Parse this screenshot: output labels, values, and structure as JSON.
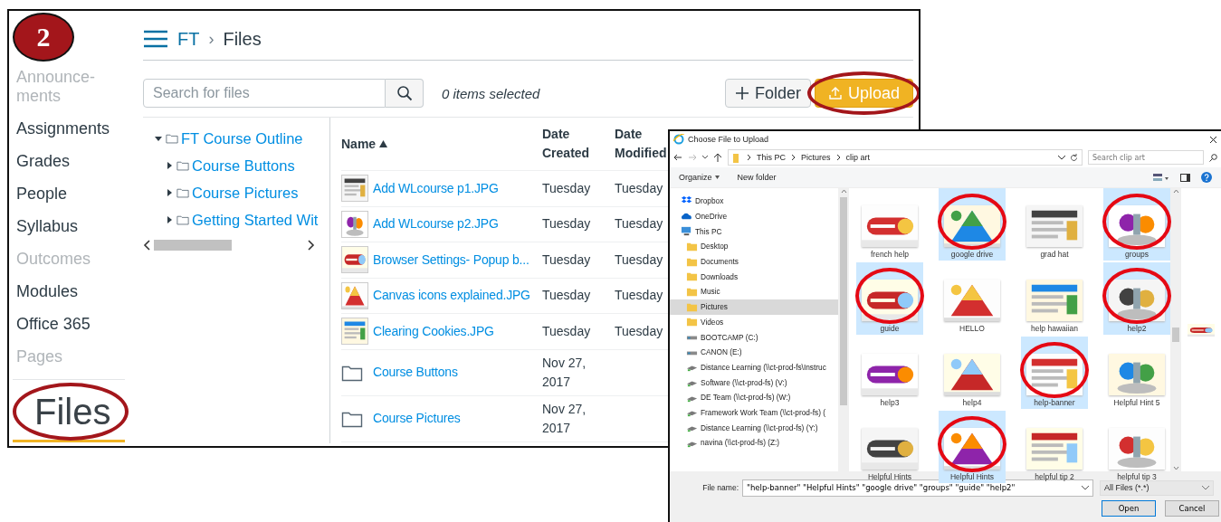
{
  "step_badge": {
    "label": "2"
  },
  "course_nav": {
    "items": [
      {
        "label": "Announce-ments",
        "muted": true,
        "selected": false,
        "circled": false
      },
      {
        "label": "Assignments",
        "muted": false,
        "selected": false,
        "circled": false
      },
      {
        "label": "Grades",
        "muted": false,
        "selected": false,
        "circled": false
      },
      {
        "label": "People",
        "muted": false,
        "selected": false,
        "circled": false
      },
      {
        "label": "Syllabus",
        "muted": false,
        "selected": false,
        "circled": false
      },
      {
        "label": "Outcomes",
        "muted": true,
        "selected": false,
        "circled": false
      },
      {
        "label": "Modules",
        "muted": false,
        "selected": false,
        "circled": false
      },
      {
        "label": "Office 365",
        "muted": false,
        "selected": false,
        "circled": false
      },
      {
        "label": "Pages",
        "muted": true,
        "selected": false,
        "circled": false
      },
      {
        "label": "Files",
        "muted": false,
        "selected": true,
        "circled": true
      }
    ]
  },
  "breadcrumbs": {
    "separator": "›",
    "items": [
      {
        "label": "FT",
        "kind": "link"
      },
      {
        "label": "Files",
        "kind": "current"
      }
    ]
  },
  "toolbar": {
    "search": {
      "placeholder": "Search for files"
    },
    "selection_count": "0 items selected",
    "buttons": [
      {
        "label": "Folder",
        "kind": "add",
        "circled": false
      },
      {
        "label": "Upload",
        "kind": "upload",
        "circled": true
      }
    ]
  },
  "folder_tree": [
    {
      "label": "FT Course Outline",
      "expanded": true,
      "children": [
        {
          "label": "Course Buttons",
          "expanded": false
        },
        {
          "label": "Course Pictures",
          "expanded": false
        },
        {
          "label": "Getting Started Wit",
          "expanded": false
        }
      ]
    }
  ],
  "file_table": {
    "columns": [
      {
        "label": "Name",
        "sorted": true
      },
      {
        "label": "Date Created",
        "sorted": false
      },
      {
        "label": "Date Modified",
        "sorted": false
      }
    ],
    "rows": [
      {
        "name": "Add WLcourse p1.JPG",
        "created": "Tuesday",
        "modified": "Tuesday"
      },
      {
        "name": "Add WLcourse p2.JPG",
        "created": "Tuesday",
        "modified": "Tuesday"
      },
      {
        "name": "Browser Settings- Popup b...",
        "created": "Tuesday",
        "modified": "Tuesday"
      },
      {
        "name": "Canvas icons explained.JPG",
        "created": "Tuesday",
        "modified": "Tuesday"
      },
      {
        "name": "Clearing Cookies.JPG",
        "created": "Tuesday",
        "modified": "Tuesday"
      },
      {
        "kind": "folder",
        "name": "Course Buttons",
        "created": "Nov 27, 2017"
      },
      {
        "kind": "folder",
        "name": "Course Pictures",
        "created": "Nov 27, 2017"
      }
    ]
  },
  "upload_dialog": {
    "title": "Choose File to Upload",
    "path": [
      "This PC",
      "Pictures",
      "clip art"
    ],
    "search": {
      "placeholder": "Search clip art"
    },
    "toolbar": [
      "Organize",
      "New folder"
    ],
    "nav": [
      {
        "label": "Dropbox",
        "kind": "dropbox",
        "selected": false
      },
      {
        "label": "OneDrive",
        "kind": "cloud",
        "selected": false
      },
      {
        "label": "This PC",
        "kind": "pc",
        "selected": false,
        "children": [
          {
            "label": "Desktop",
            "kind": "folder",
            "selected": false
          },
          {
            "label": "Documents",
            "kind": "folder",
            "selected": false
          },
          {
            "label": "Downloads",
            "kind": "folder",
            "selected": false
          },
          {
            "label": "Music",
            "kind": "folder",
            "selected": false
          },
          {
            "label": "Pictures",
            "kind": "folder",
            "selected": true
          },
          {
            "label": "Videos",
            "kind": "folder",
            "selected": false
          },
          {
            "label": "BOOTCAMP (C:)",
            "kind": "drive",
            "selected": false
          },
          {
            "label": "CANON (E:)",
            "kind": "drive",
            "selected": false
          },
          {
            "label": "Distance Learning (\\\\ct-prod-fs\\Instruc",
            "kind": "network",
            "selected": false
          },
          {
            "label": "Software (\\\\ct-prod-fs) (V:)",
            "kind": "network",
            "selected": false
          },
          {
            "label": "DE Team (\\\\ct-prod-fs) (W:)",
            "kind": "network",
            "selected": false
          },
          {
            "label": "Framework Work Team (\\\\ct-prod-fs) (",
            "kind": "network",
            "selected": false
          },
          {
            "label": "Distance Learning (\\\\ct-prod-fs) (Y:)",
            "kind": "network",
            "selected": false
          },
          {
            "label": "navina (\\\\ct-prod-fs) (Z:)",
            "kind": "network",
            "selected": false
          }
        ]
      }
    ],
    "files": [
      {
        "label": "french help",
        "selected": false,
        "circled": false
      },
      {
        "label": "google drive",
        "selected": true,
        "circled": true
      },
      {
        "label": "grad hat",
        "selected": false,
        "circled": false
      },
      {
        "label": "groups",
        "selected": true,
        "circled": true
      },
      {
        "label": "guide",
        "selected": true,
        "circled": true
      },
      {
        "label": "HELLO",
        "selected": false,
        "circled": false
      },
      {
        "label": "help hawaiian",
        "selected": false,
        "circled": false
      },
      {
        "label": "help2",
        "selected": true,
        "circled": true
      },
      {
        "label": "help3",
        "selected": false,
        "circled": false
      },
      {
        "label": "help4",
        "selected": false,
        "circled": false
      },
      {
        "label": "help-banner",
        "selected": true,
        "circled": true
      },
      {
        "label": "Helpful Hint 5",
        "selected": false,
        "circled": false
      },
      {
        "label": "Helpful Hints",
        "selected": false,
        "circled": false
      },
      {
        "label": "Helpful Hints",
        "selected": true,
        "circled": true
      },
      {
        "label": "helpful tip 2",
        "selected": false,
        "circled": false
      },
      {
        "label": "helpful tip 3",
        "selected": false,
        "circled": false
      }
    ],
    "file_name": {
      "label": "File name:",
      "value": "\"help-banner\" \"Helpful Hints\" \"google drive\" \"groups\" \"guide\" \"help2\""
    },
    "file_type": "All Files (*.*)",
    "buttons": [
      {
        "label": "Open",
        "default": true
      },
      {
        "label": "Cancel",
        "default": false
      }
    ]
  }
}
